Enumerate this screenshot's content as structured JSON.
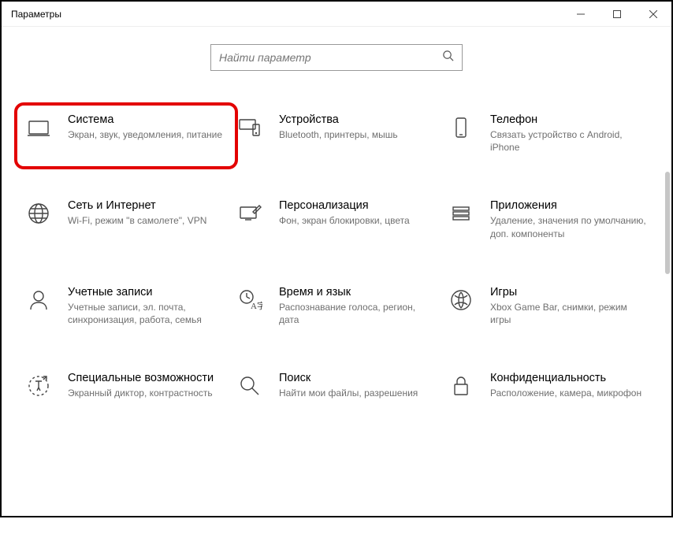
{
  "window": {
    "title": "Параметры"
  },
  "search": {
    "placeholder": "Найти параметр"
  },
  "tiles": [
    {
      "id": "system",
      "title": "Система",
      "desc": "Экран, звук, уведомления, питание",
      "highlight": true
    },
    {
      "id": "devices",
      "title": "Устройства",
      "desc": "Bluetooth, принтеры, мышь"
    },
    {
      "id": "phone",
      "title": "Телефон",
      "desc": "Связать устройство с Android, iPhone"
    },
    {
      "id": "network",
      "title": "Сеть и Интернет",
      "desc": "Wi-Fi, режим \"в самолете\", VPN"
    },
    {
      "id": "personalization",
      "title": "Персонализация",
      "desc": "Фон, экран блокировки, цвета"
    },
    {
      "id": "apps",
      "title": "Приложения",
      "desc": "Удаление, значения по умолчанию, доп. компоненты"
    },
    {
      "id": "accounts",
      "title": "Учетные записи",
      "desc": "Учетные записи, эл. почта, синхронизация, работа, семья"
    },
    {
      "id": "time",
      "title": "Время и язык",
      "desc": "Распознавание голоса, регион, дата"
    },
    {
      "id": "gaming",
      "title": "Игры",
      "desc": "Xbox Game Bar, снимки, режим игры"
    },
    {
      "id": "ease",
      "title": "Специальные возможности",
      "desc": "Экранный диктор, контрастность"
    },
    {
      "id": "searchcat",
      "title": "Поиск",
      "desc": "Найти мои файлы, разрешения"
    },
    {
      "id": "privacy",
      "title": "Конфиденциальность",
      "desc": "Расположение, камера, микрофон"
    }
  ]
}
